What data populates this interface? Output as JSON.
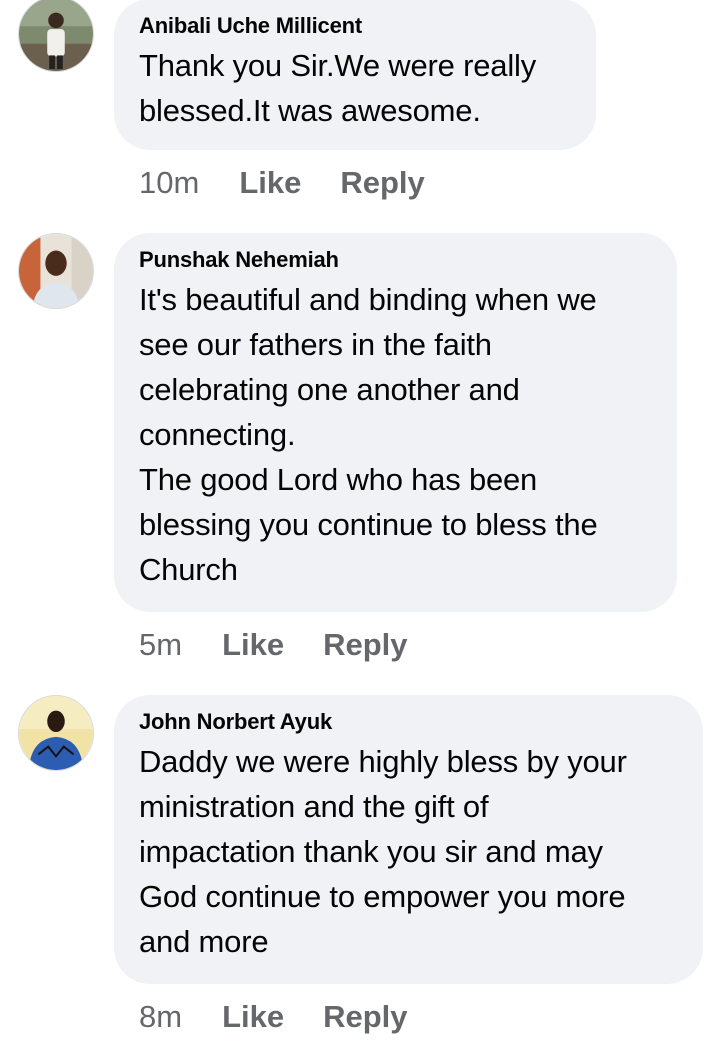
{
  "comments": [
    {
      "author": "Anibali Uche Millicent",
      "text": "Thank you Sir.We were really\nblessed.It was awesome.",
      "time": "10m",
      "like_label": "Like",
      "reply_label": "Reply"
    },
    {
      "author": "Punshak Nehemiah",
      "text": "It's beautiful and binding when we\nsee our fathers in the faith\ncelebrating one another and\nconnecting.\nThe good Lord who has been\nblessing you continue to bless the\nChurch",
      "time": "5m",
      "like_label": "Like",
      "reply_label": "Reply"
    },
    {
      "author": "John Norbert Ayuk",
      "text": "Daddy we were highly bless by your\nministration and the gift of\nimpactation thank you sir and may\nGod continue to empower you more\nand more",
      "time": "8m",
      "like_label": "Like",
      "reply_label": "Reply"
    }
  ],
  "colors": {
    "bubble": "#f0f2f5",
    "meta_text": "#65676b",
    "body_text": "#050505"
  }
}
